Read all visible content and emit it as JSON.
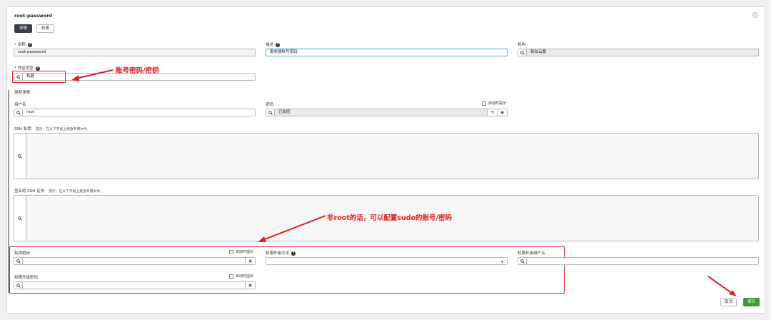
{
  "window": {
    "title": "root-password"
  },
  "tabs": [
    {
      "label": "详情"
    },
    {
      "label": "权限"
    }
  ],
  "fields": {
    "name": {
      "label": "名称",
      "value": "root-password"
    },
    "description": {
      "label": "描述",
      "value": "服务器账号密码"
    },
    "organization": {
      "label": "机构",
      "value": "新钛云服"
    },
    "credential_type": {
      "label": "凭证类型",
      "value": "机器"
    }
  },
  "type_details": {
    "title": "类型详情",
    "username": {
      "label": "用户名",
      "value": "root"
    },
    "password": {
      "label": "密码",
      "value": "已加密",
      "prompt_label": "启动时提示"
    },
    "ssh_key": {
      "label": "SSH 私钥",
      "hint": "提示：在以下字段上拖放专用文件。"
    },
    "ssh_cert": {
      "label": "签名的 SSH 证书",
      "hint": "提示：在以下字段上拖放专用文件。"
    },
    "key_passphrase": {
      "label": "私钥密码",
      "prompt_label": "启动时提示"
    },
    "become_method": {
      "label": "权限升级方法"
    },
    "become_username": {
      "label": "权限升级用户名"
    },
    "become_password": {
      "label": "权限升级密码",
      "prompt_label": "启动时提示"
    }
  },
  "actions": {
    "cancel": "取消",
    "save": "保存"
  },
  "annotations": {
    "credential_note": "账号密码/密钥",
    "sudo_note": "非root的话，可以配置sudo的账号/密码"
  },
  "colors": {
    "accent_red": "#e02020",
    "save_green": "#3f9c35",
    "active_tab": "#393f44"
  }
}
